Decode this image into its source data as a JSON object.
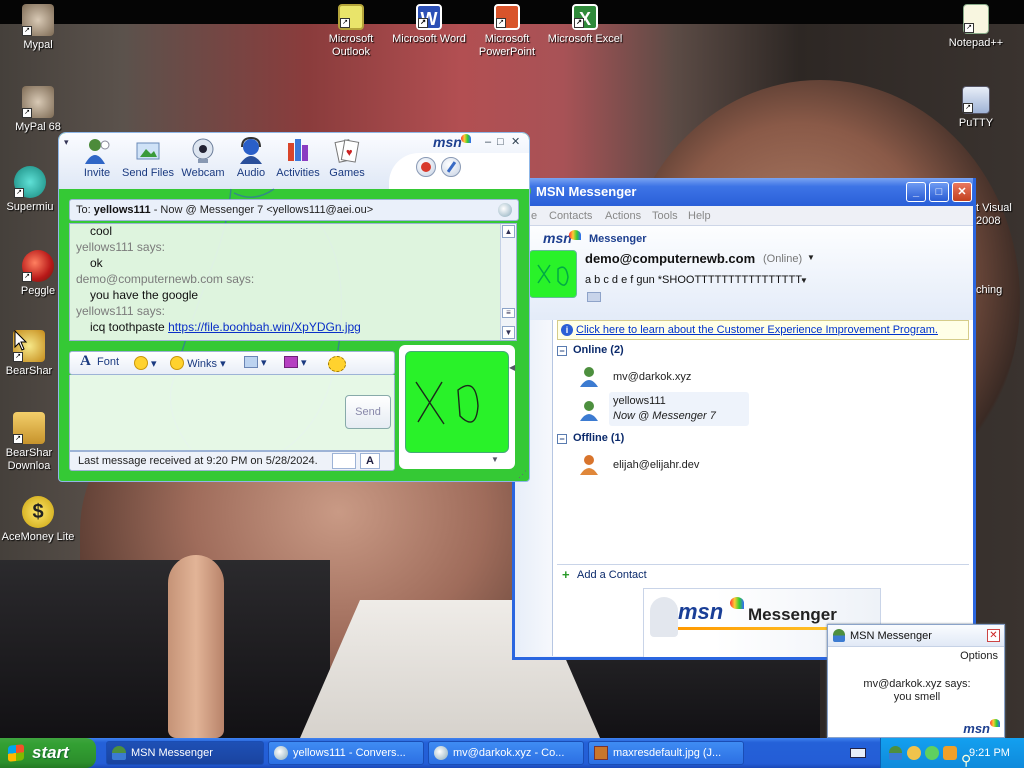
{
  "desktop": {
    "icons_left": [
      {
        "name": "mypal-icon",
        "label": "Mypal"
      },
      {
        "name": "mypal68-icon",
        "label": "MyPal 68"
      },
      {
        "name": "supermium-icon",
        "label": "Supermiu"
      },
      {
        "name": "peggle-icon",
        "label": "Peggle"
      },
      {
        "name": "bearshare-icon",
        "label": "BearShar"
      },
      {
        "name": "bearshare-downloads-icon",
        "label": "BearShar Downloa"
      },
      {
        "name": "acemoney-icon",
        "label": "AceMoney Lite"
      }
    ],
    "icons_top": [
      {
        "name": "outlook-icon",
        "label": "Microsoft Outlook"
      },
      {
        "name": "word-icon",
        "label": "Microsoft Word"
      },
      {
        "name": "powerpoint-icon",
        "label": "Microsoft PowerPoint"
      },
      {
        "name": "excel-icon",
        "label": "Microsoft Excel"
      }
    ],
    "icons_right": [
      {
        "name": "notepadpp-icon",
        "label": "Notepad++"
      },
      {
        "name": "putty-icon",
        "label": "PuTTY"
      },
      {
        "name": "visual-studio-icon",
        "label": "t Visual 2008"
      },
      {
        "name": "ching-icon",
        "label": "ching"
      }
    ]
  },
  "conversation": {
    "brand": "msn",
    "toolbar": [
      "Invite",
      "Send Files",
      "Webcam",
      "Audio",
      "Activities",
      "Games"
    ],
    "to_label": "To:",
    "to_name": "yellows111",
    "to_status": "- Now @ Messenger 7 <yellows111@aei.ou>",
    "history": {
      "l1": "cool",
      "l2": "yellows111 says:",
      "l3": "ok",
      "l4": "demo@computernewb.com says:",
      "l5": "you have the google",
      "l6": "yellows111 says:",
      "l7_text": "icq toothpaste",
      "l7_link": "https://file.boohbah.win/XpYDGn.jpg"
    },
    "format": {
      "font": "Font",
      "winks": "Winks"
    },
    "send": "Send",
    "status": "Last message received at 9:20 PM on 5/28/2024."
  },
  "messenger": {
    "title": "MSN Messenger",
    "menu": [
      "e",
      "Contacts",
      "Actions",
      "Tools",
      "Help"
    ],
    "brand": "msn",
    "brand_suffix": "Messenger",
    "my_name": "demo@computernewb.com",
    "my_status": "(Online)",
    "personal_message": "a b c d e f gun *SHOOTTTTTTTTTTTTTTTT-",
    "info_link": "Click here to learn about the Customer Experience Improvement Program.",
    "group_online": "Online (2)",
    "group_offline": "Offline (1)",
    "contact1": "mv@darkok.xyz",
    "contact2_name": "yellows111",
    "contact2_status": "Now @ Messenger 7",
    "contact3": "elijah@elijahr.dev",
    "add_contact": "Add a Contact",
    "banner_brand": "msn",
    "banner_text": "Messenger"
  },
  "toast": {
    "title": "MSN Messenger",
    "options": "Options",
    "line1": "mv@darkok.xyz says:",
    "line2": "you smell",
    "brand": "msn"
  },
  "taskbar": {
    "start": "start",
    "tasks": [
      "MSN Messenger",
      "yellows111 - Convers...",
      "mv@darkok.xyz - Co...",
      "maxresdefault.jpg (J..."
    ],
    "clock": "9:21 PM"
  },
  "colors": {
    "accent": "#2a66e0",
    "conv_green": "#35c935",
    "dp_green": "#29f229"
  }
}
